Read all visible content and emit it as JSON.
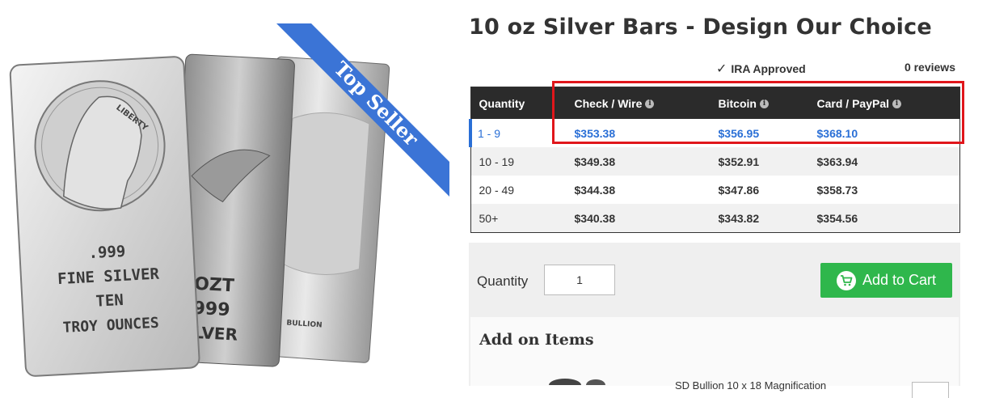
{
  "product": {
    "title": "10 oz Silver Bars - Design Our Choice",
    "ribbon": "Top Seller",
    "ira_label": "IRA Approved",
    "reviews": "0 reviews",
    "bar_text": {
      "line1": ".999",
      "line2": "FINE SILVER",
      "line3": "TEN",
      "line4": "TROY OUNCES",
      "medallion": "LIBERTY",
      "bar2_line1": "OZT",
      "bar2_line2": "999",
      "bar2_line3": "ILVER",
      "bar3_mark": "BULLION"
    }
  },
  "pricing": {
    "headers": [
      "Quantity",
      "Check / Wire",
      "Bitcoin",
      "Card / PayPal"
    ],
    "rows": [
      {
        "qty": "1 - 9",
        "check": "$353.38",
        "bitcoin": "$356.95",
        "card": "$368.10"
      },
      {
        "qty": "10 - 19",
        "check": "$349.38",
        "bitcoin": "$352.91",
        "card": "$363.94"
      },
      {
        "qty": "20 - 49",
        "check": "$344.38",
        "bitcoin": "$347.86",
        "card": "$358.73"
      },
      {
        "qty": "50+",
        "check": "$340.38",
        "bitcoin": "$343.82",
        "card": "$354.56"
      }
    ],
    "active_color": "#2a6fd6",
    "highlight_color": "#e0161b"
  },
  "purchase": {
    "quantity_label": "Quantity",
    "quantity_value": "1",
    "add_to_cart": "Add to Cart",
    "button_color": "#2fb74c"
  },
  "addons": {
    "title": "Add on Items",
    "item_name": "SD Bullion 10 x 18 Magnification"
  }
}
